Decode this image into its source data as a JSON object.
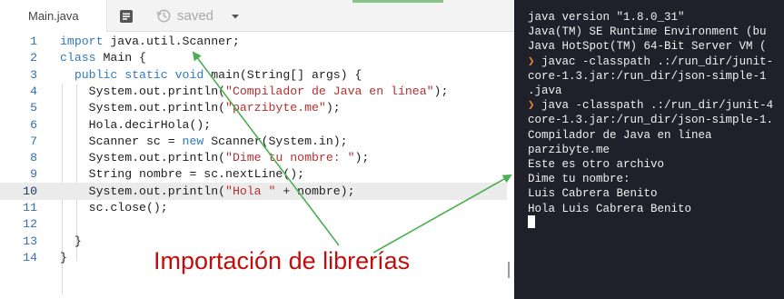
{
  "editor": {
    "tab": {
      "filename": "Main.java"
    },
    "toolbar": {
      "format_icon": "format-icon",
      "save_icon": "save-status-icon",
      "save_status": "saved",
      "dropdown_icon": "chevron-down-icon"
    },
    "active_line": 10,
    "lines": [
      {
        "num": "1",
        "tokens": [
          {
            "t": "import",
            "c": "kw"
          },
          {
            "t": " java.util.Scanner;"
          }
        ]
      },
      {
        "num": "2",
        "tokens": [
          {
            "t": "class",
            "c": "kw"
          },
          {
            "t": " Main {"
          }
        ]
      },
      {
        "num": "3",
        "tokens": [
          {
            "t": "  "
          },
          {
            "t": "public",
            "c": "kw"
          },
          {
            "t": " "
          },
          {
            "t": "static",
            "c": "kw"
          },
          {
            "t": " "
          },
          {
            "t": "void",
            "c": "kw"
          },
          {
            "t": " main(String[] args) {"
          }
        ]
      },
      {
        "num": "4",
        "tokens": [
          {
            "t": "    System.out.println("
          },
          {
            "t": "\"Compilador de Java en línea\"",
            "c": "str"
          },
          {
            "t": ");"
          }
        ]
      },
      {
        "num": "5",
        "tokens": [
          {
            "t": "    System.out.println("
          },
          {
            "t": "\"parzibyte.me\"",
            "c": "str"
          },
          {
            "t": ");"
          }
        ]
      },
      {
        "num": "6",
        "tokens": [
          {
            "t": "    Hola.decirHola();"
          }
        ]
      },
      {
        "num": "7",
        "tokens": [
          {
            "t": "    Scanner sc = "
          },
          {
            "t": "new",
            "c": "kw"
          },
          {
            "t": " Scanner(System.in);"
          }
        ]
      },
      {
        "num": "8",
        "tokens": [
          {
            "t": "    System.out.println("
          },
          {
            "t": "\"Dime tu nombre: \"",
            "c": "str"
          },
          {
            "t": ");"
          }
        ]
      },
      {
        "num": "9",
        "tokens": [
          {
            "t": "    String nombre = sc.nextLine();"
          }
        ]
      },
      {
        "num": "10",
        "tokens": [
          {
            "t": "    System.out.println("
          },
          {
            "t": "\"Hola \"",
            "c": "str"
          },
          {
            "t": " + nombre);"
          }
        ]
      },
      {
        "num": "11",
        "tokens": [
          {
            "t": "    sc.close();"
          }
        ]
      },
      {
        "num": "12",
        "tokens": []
      },
      {
        "num": "13",
        "tokens": [
          {
            "t": "  }"
          }
        ]
      },
      {
        "num": "14",
        "tokens": [
          {
            "t": "}"
          }
        ]
      }
    ]
  },
  "console": {
    "lines": [
      {
        "prompt": "",
        "text": "java version \"1.8.0_31\""
      },
      {
        "prompt": "",
        "text": "Java(TM) SE Runtime Environment (bu"
      },
      {
        "prompt": "",
        "text": "Java HotSpot(TM) 64-Bit Server VM ("
      },
      {
        "prompt": "❯",
        "text": " javac -classpath .:/run_dir/junit-"
      },
      {
        "prompt": "",
        "text": "core-1.3.jar:/run_dir/json-simple-1"
      },
      {
        "prompt": "",
        "text": ".java"
      },
      {
        "prompt": "❯",
        "text": " java -classpath .:/run_dir/junit-4"
      },
      {
        "prompt": "",
        "text": "core-1.3.jar:/run_dir/json-simple-1."
      },
      {
        "prompt": "",
        "text": "Compilador de Java en línea"
      },
      {
        "prompt": "",
        "text": "parzibyte.me"
      },
      {
        "prompt": "",
        "text": "Este es otro archivo"
      },
      {
        "prompt": "",
        "text": "Dime tu nombre:"
      },
      {
        "prompt": "",
        "text": "Luis Cabrera Benito"
      },
      {
        "prompt": "",
        "text": "Hola Luis Cabrera Benito"
      }
    ]
  },
  "annotation": {
    "caption": "Importación de librerías",
    "color": "#c00d0d",
    "arrow_color": "#4caf50"
  }
}
